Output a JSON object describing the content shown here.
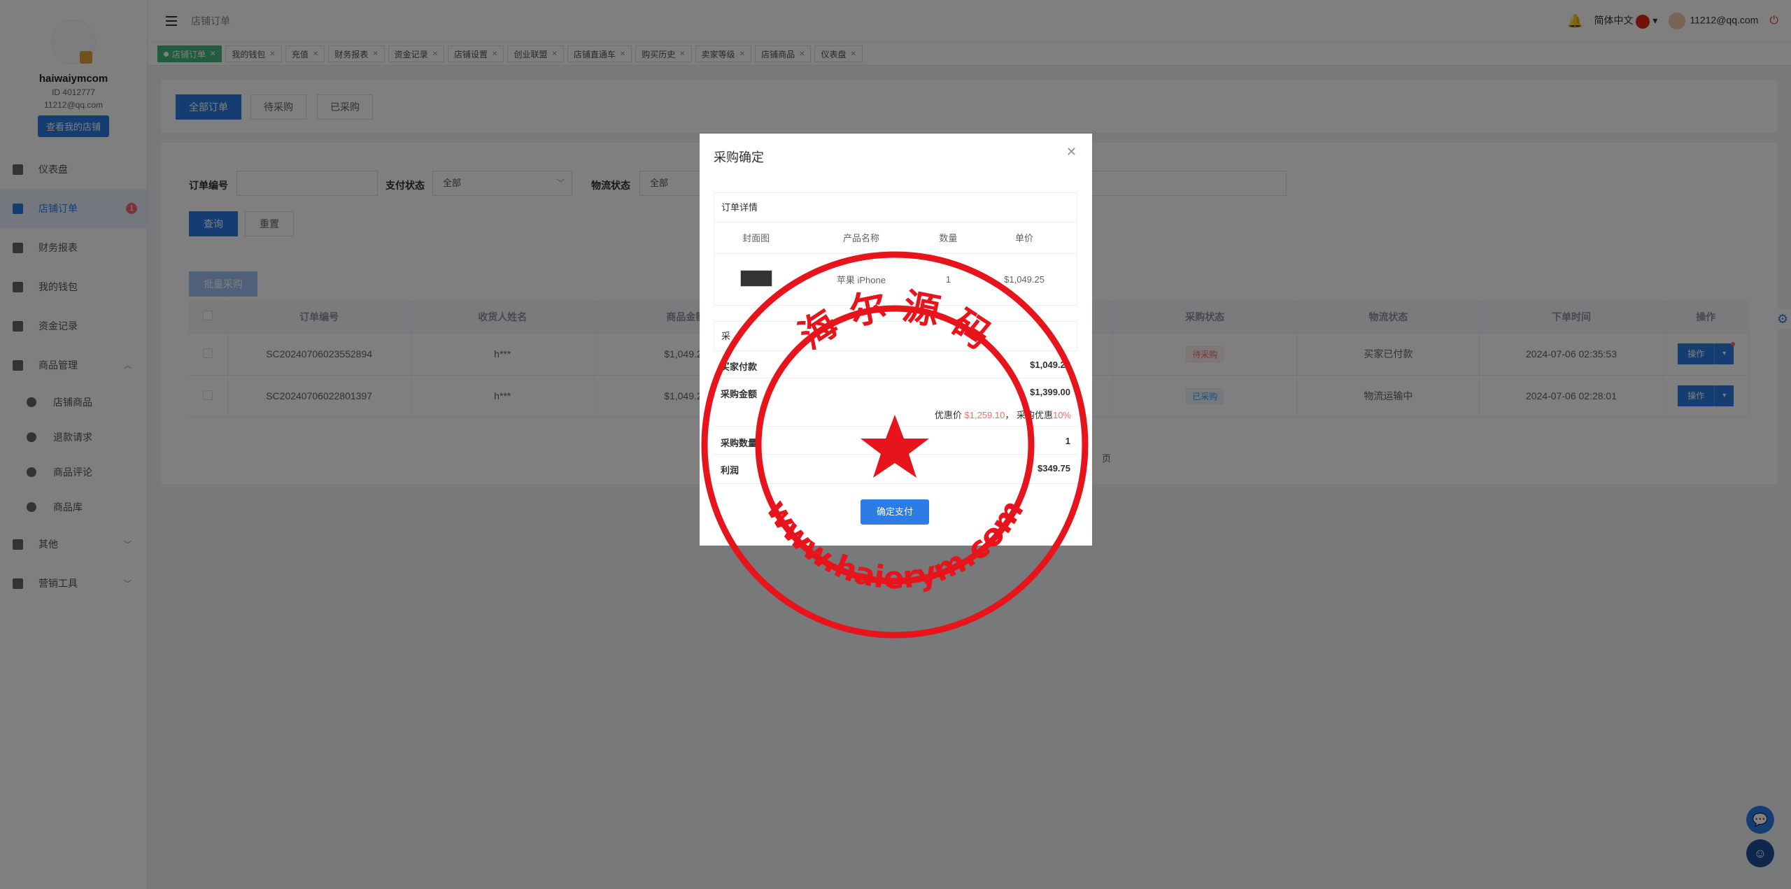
{
  "sidebar": {
    "username": "haiwaiymcom",
    "id": "ID 4012777",
    "email": "11212@qq.com",
    "shop_button": "查看我的店铺",
    "items": [
      {
        "label": "仪表盘"
      },
      {
        "label": "店铺订单",
        "badge": "1"
      },
      {
        "label": "财务报表"
      },
      {
        "label": "我的钱包"
      },
      {
        "label": "资金记录"
      },
      {
        "label": "商品管理"
      },
      {
        "label": "店铺商品"
      },
      {
        "label": "退款请求"
      },
      {
        "label": "商品评论"
      },
      {
        "label": "商品库"
      },
      {
        "label": "其他"
      },
      {
        "label": "营销工具"
      }
    ]
  },
  "topbar": {
    "breadcrumb": "店铺订单",
    "language": "简体中文",
    "user_email": "11212@qq.com"
  },
  "tags": [
    "店铺订单",
    "我的钱包",
    "充值",
    "财务报表",
    "资金记录",
    "店铺设置",
    "创业联盟",
    "店铺直通车",
    "购买历史",
    "卖家等级",
    "店铺商品",
    "仪表盘"
  ],
  "tabs": {
    "all": "全部订单",
    "pending": "待采购",
    "purchased": "已采购"
  },
  "filters": {
    "order_no_label": "订单编号",
    "pay_status_label": "支付状态",
    "pay_status_value": "全部",
    "logistics_label": "物流状态",
    "logistics_value": "全部",
    "search_button": "查询",
    "reset_button": "重置",
    "batch_button": "批量采购"
  },
  "table": {
    "headers": [
      "订单编号",
      "收货人姓名",
      "商品金额",
      "采购状态",
      "物流状态",
      "下单时间",
      "操作"
    ],
    "rows": [
      {
        "order_no": "SC20240706023552894",
        "receiver": "h***",
        "amount": "$1,049.25",
        "purchase_status": "待采购",
        "logistics": "买家已付款",
        "time": "2024-07-06 02:35:53",
        "op": "操作"
      },
      {
        "order_no": "SC20240706022801397",
        "receiver": "h***",
        "amount": "$1,049.25",
        "purchase_status": "已采购",
        "logistics": "物流运输中",
        "time": "2024-07-06 02:28:01",
        "op": "操作"
      }
    ],
    "pager_text": "页"
  },
  "modal": {
    "title": "采购确定",
    "detail_title": "订单详情",
    "columns": [
      "封面图",
      "产品名称",
      "数量",
      "单价"
    ],
    "product_name": "苹果 iPhone",
    "quantity": "1",
    "unit_price": "$1,049.25",
    "summary_title": "采",
    "buyer_paid_label": "买家付款",
    "buyer_paid": "$1,049.25",
    "purchase_amount_label": "采购金额",
    "purchase_amount": "$1,399.00",
    "discount_prefix": "优惠价",
    "discount_price": "$1,259.10",
    "discount_mid": "， 采购优惠",
    "discount_percent": "10%",
    "purchase_qty_label": "采购数量",
    "purchase_qty": "1",
    "profit_label": "利润",
    "profit": "$349.75",
    "confirm_button": "确定支付"
  },
  "watermark": {
    "top_text": "海 尔 源 码",
    "bottom_text": "www.haierym.com",
    "color": "#e8141b"
  }
}
